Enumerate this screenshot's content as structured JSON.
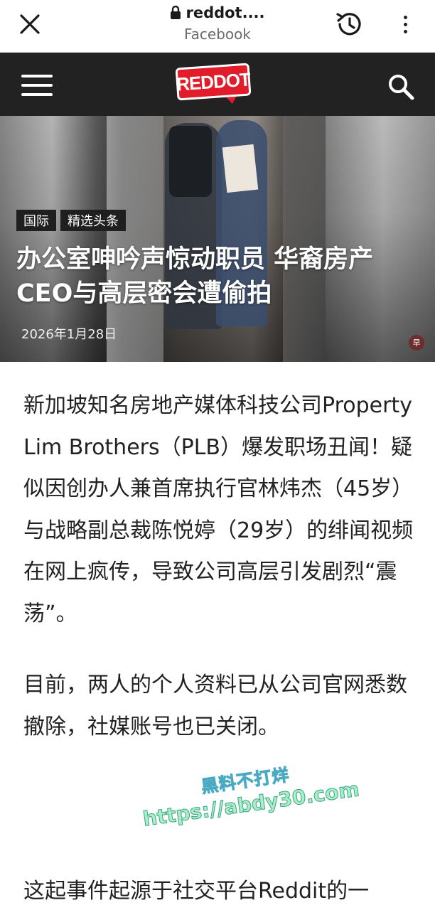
{
  "browser": {
    "url": "reddot....",
    "source": "Facebook",
    "icons": {
      "close": "close-icon",
      "lock": "lock-icon",
      "history": "history-icon",
      "more": "more-vertical-icon"
    }
  },
  "site": {
    "logo_text": "REDDOT",
    "colors": {
      "header_bg": "#222222",
      "logo_red": "#e21d2b"
    },
    "icons": {
      "menu": "hamburger-menu-icon",
      "search": "search-icon"
    }
  },
  "hero": {
    "tags": [
      "国际",
      "精选头条"
    ],
    "title": "办公室呻吟声惊动职员 华裔房产CEO与高层密会遭偷拍",
    "date": "2026年1月28日"
  },
  "article": {
    "paragraphs": [
      "新加坡知名房地产媒体科技公司Property Lim Brothers（PLB）爆发职场丑闻！疑似因创办人兼首席执行官林炜杰（45岁）与战略副总裁陈悦婷（29岁）的绯闻视频在网上疯传，导致公司高层引发剧烈“震荡”。",
      "目前，两人的个人资料已从公司官网悉数撤除，社媒账号也已关闭。",
      "这起事件起源于社交平台Reddit的一"
    ]
  },
  "watermark": {
    "line1": "黑料不打烊",
    "line2": "https://abdy30.com"
  }
}
